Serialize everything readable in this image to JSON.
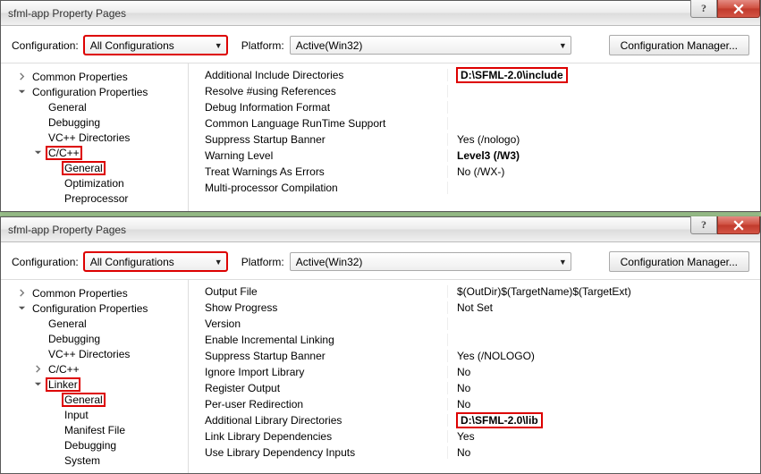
{
  "windows": [
    {
      "title": "sfml-app Property Pages",
      "toolbar": {
        "config_label": "Configuration:",
        "config_value": "All Configurations",
        "platform_label": "Platform:",
        "platform_value": "Active(Win32)",
        "manager_btn": "Configuration Manager..."
      },
      "tree": [
        {
          "label": "Common Properties",
          "depth": 0,
          "exp": "closed"
        },
        {
          "label": "Configuration Properties",
          "depth": 0,
          "exp": "open"
        },
        {
          "label": "General",
          "depth": 1,
          "exp": "none"
        },
        {
          "label": "Debugging",
          "depth": 1,
          "exp": "none"
        },
        {
          "label": "VC++ Directories",
          "depth": 1,
          "exp": "none"
        },
        {
          "label": "C/C++",
          "depth": 1,
          "exp": "open",
          "hl": true
        },
        {
          "label": "General",
          "depth": 2,
          "exp": "none",
          "hl": true
        },
        {
          "label": "Optimization",
          "depth": 2,
          "exp": "none"
        },
        {
          "label": "Preprocessor",
          "depth": 2,
          "exp": "none"
        }
      ],
      "rows": [
        {
          "l": "Additional Include Directories",
          "r": "D:\\SFML-2.0\\include",
          "bold": true,
          "hl": true
        },
        {
          "l": "Resolve #using References",
          "r": ""
        },
        {
          "l": "Debug Information Format",
          "r": ""
        },
        {
          "l": "Common Language RunTime Support",
          "r": ""
        },
        {
          "l": "Suppress Startup Banner",
          "r": "Yes (/nologo)"
        },
        {
          "l": "Warning Level",
          "r": "Level3 (/W3)",
          "bold": true
        },
        {
          "l": "Treat Warnings As Errors",
          "r": "No (/WX-)"
        },
        {
          "l": "Multi-processor Compilation",
          "r": ""
        }
      ]
    },
    {
      "title": "sfml-app Property Pages",
      "toolbar": {
        "config_label": "Configuration:",
        "config_value": "All Configurations",
        "platform_label": "Platform:",
        "platform_value": "Active(Win32)",
        "manager_btn": "Configuration Manager..."
      },
      "tree": [
        {
          "label": "Common Properties",
          "depth": 0,
          "exp": "closed"
        },
        {
          "label": "Configuration Properties",
          "depth": 0,
          "exp": "open"
        },
        {
          "label": "General",
          "depth": 1,
          "exp": "none"
        },
        {
          "label": "Debugging",
          "depth": 1,
          "exp": "none"
        },
        {
          "label": "VC++ Directories",
          "depth": 1,
          "exp": "none"
        },
        {
          "label": "C/C++",
          "depth": 1,
          "exp": "closed"
        },
        {
          "label": "Linker",
          "depth": 1,
          "exp": "open",
          "hl": true
        },
        {
          "label": "General",
          "depth": 2,
          "exp": "none",
          "hl": true
        },
        {
          "label": "Input",
          "depth": 2,
          "exp": "none"
        },
        {
          "label": "Manifest File",
          "depth": 2,
          "exp": "none"
        },
        {
          "label": "Debugging",
          "depth": 2,
          "exp": "none"
        },
        {
          "label": "System",
          "depth": 2,
          "exp": "none"
        }
      ],
      "rows": [
        {
          "l": "Output File",
          "r": "$(OutDir)$(TargetName)$(TargetExt)"
        },
        {
          "l": "Show Progress",
          "r": "Not Set"
        },
        {
          "l": "Version",
          "r": ""
        },
        {
          "l": "Enable Incremental Linking",
          "r": ""
        },
        {
          "l": "Suppress Startup Banner",
          "r": "Yes (/NOLOGO)"
        },
        {
          "l": "Ignore Import Library",
          "r": "No"
        },
        {
          "l": "Register Output",
          "r": "No"
        },
        {
          "l": "Per-user Redirection",
          "r": "No"
        },
        {
          "l": "Additional Library Directories",
          "r": "D:\\SFML-2.0\\lib",
          "bold": true,
          "hl": true
        },
        {
          "l": "Link Library Dependencies",
          "r": "Yes"
        },
        {
          "l": "Use Library Dependency Inputs",
          "r": "No"
        }
      ]
    }
  ]
}
